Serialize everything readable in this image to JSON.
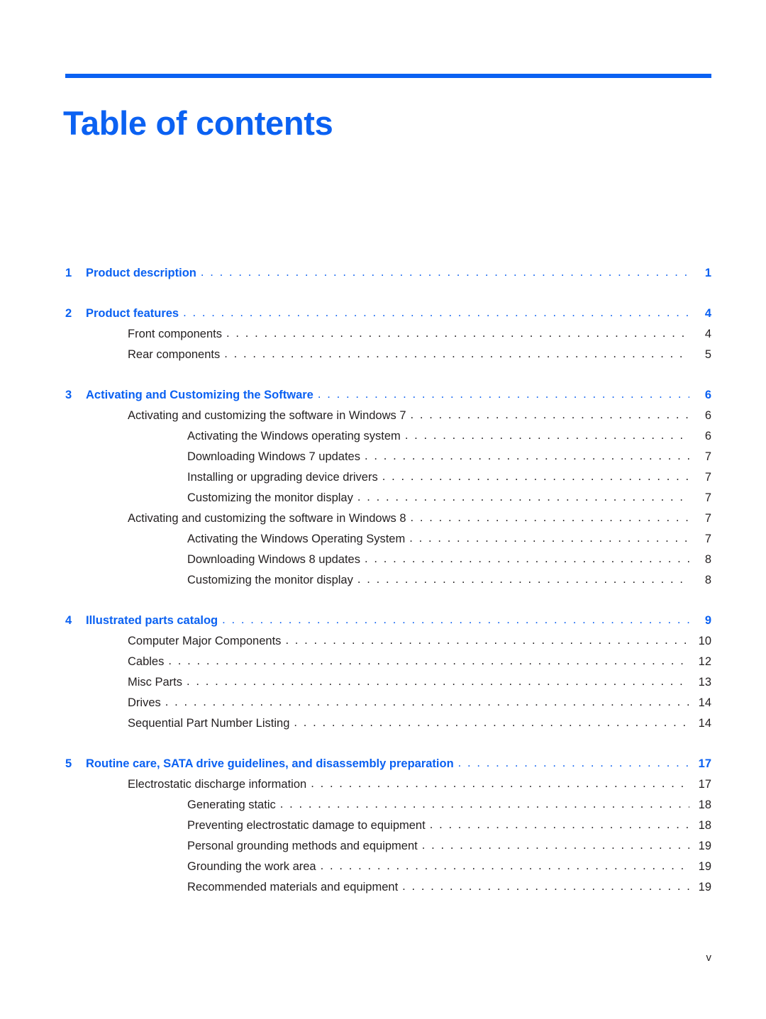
{
  "document": {
    "title": "Table of contents",
    "folio": "v",
    "accent_color": "#0b61f2",
    "body_color": "#231f20",
    "leader_char": "."
  },
  "toc": {
    "entries": [
      {
        "level": 1,
        "num": "1",
        "label": "Product description",
        "page": "1",
        "gap_before": false
      },
      {
        "level": 1,
        "num": "2",
        "label": "Product features",
        "page": "4",
        "gap_before": true
      },
      {
        "level": 2,
        "num": "",
        "label": "Front components",
        "page": "4",
        "gap_before": false
      },
      {
        "level": 2,
        "num": "",
        "label": "Rear components",
        "page": "5",
        "gap_before": false
      },
      {
        "level": 1,
        "num": "3",
        "label": "Activating and Customizing the Software",
        "page": "6",
        "gap_before": true
      },
      {
        "level": 2,
        "num": "",
        "label": "Activating and customizing the software in Windows 7",
        "page": "6",
        "gap_before": false
      },
      {
        "level": 3,
        "num": "",
        "label": "Activating the Windows operating system",
        "page": "6",
        "gap_before": false
      },
      {
        "level": 3,
        "num": "",
        "label": "Downloading Windows 7 updates",
        "page": "7",
        "gap_before": false
      },
      {
        "level": 3,
        "num": "",
        "label": "Installing or upgrading device drivers",
        "page": "7",
        "gap_before": false
      },
      {
        "level": 3,
        "num": "",
        "label": "Customizing the monitor display",
        "page": "7",
        "gap_before": false
      },
      {
        "level": 2,
        "num": "",
        "label": "Activating and customizing the software in Windows 8",
        "page": "7",
        "gap_before": false
      },
      {
        "level": 3,
        "num": "",
        "label": "Activating the Windows Operating System",
        "page": "7",
        "gap_before": false
      },
      {
        "level": 3,
        "num": "",
        "label": "Downloading Windows 8 updates",
        "page": "8",
        "gap_before": false
      },
      {
        "level": 3,
        "num": "",
        "label": "Customizing the monitor display",
        "page": "8",
        "gap_before": false
      },
      {
        "level": 1,
        "num": "4",
        "label": "Illustrated parts catalog",
        "page": "9",
        "gap_before": true
      },
      {
        "level": 2,
        "num": "",
        "label": "Computer Major Components",
        "page": "10",
        "gap_before": false
      },
      {
        "level": 2,
        "num": "",
        "label": "Cables",
        "page": "12",
        "gap_before": false
      },
      {
        "level": 2,
        "num": "",
        "label": "Misc Parts",
        "page": "13",
        "gap_before": false
      },
      {
        "level": 2,
        "num": "",
        "label": "Drives",
        "page": "14",
        "gap_before": false
      },
      {
        "level": 2,
        "num": "",
        "label": "Sequential Part Number Listing",
        "page": "14",
        "gap_before": false
      },
      {
        "level": 1,
        "num": "5",
        "label": "Routine care, SATA drive guidelines, and disassembly preparation",
        "page": "17",
        "gap_before": true
      },
      {
        "level": 2,
        "num": "",
        "label": "Electrostatic discharge information",
        "page": "17",
        "gap_before": false
      },
      {
        "level": 3,
        "num": "",
        "label": "Generating static",
        "page": "18",
        "gap_before": false
      },
      {
        "level": 3,
        "num": "",
        "label": "Preventing electrostatic damage to equipment",
        "page": "18",
        "gap_before": false
      },
      {
        "level": 3,
        "num": "",
        "label": "Personal grounding methods and equipment",
        "page": "19",
        "gap_before": false
      },
      {
        "level": 3,
        "num": "",
        "label": "Grounding the work area",
        "page": "19",
        "gap_before": false
      },
      {
        "level": 3,
        "num": "",
        "label": "Recommended materials and equipment",
        "page": "19",
        "gap_before": false
      }
    ]
  }
}
